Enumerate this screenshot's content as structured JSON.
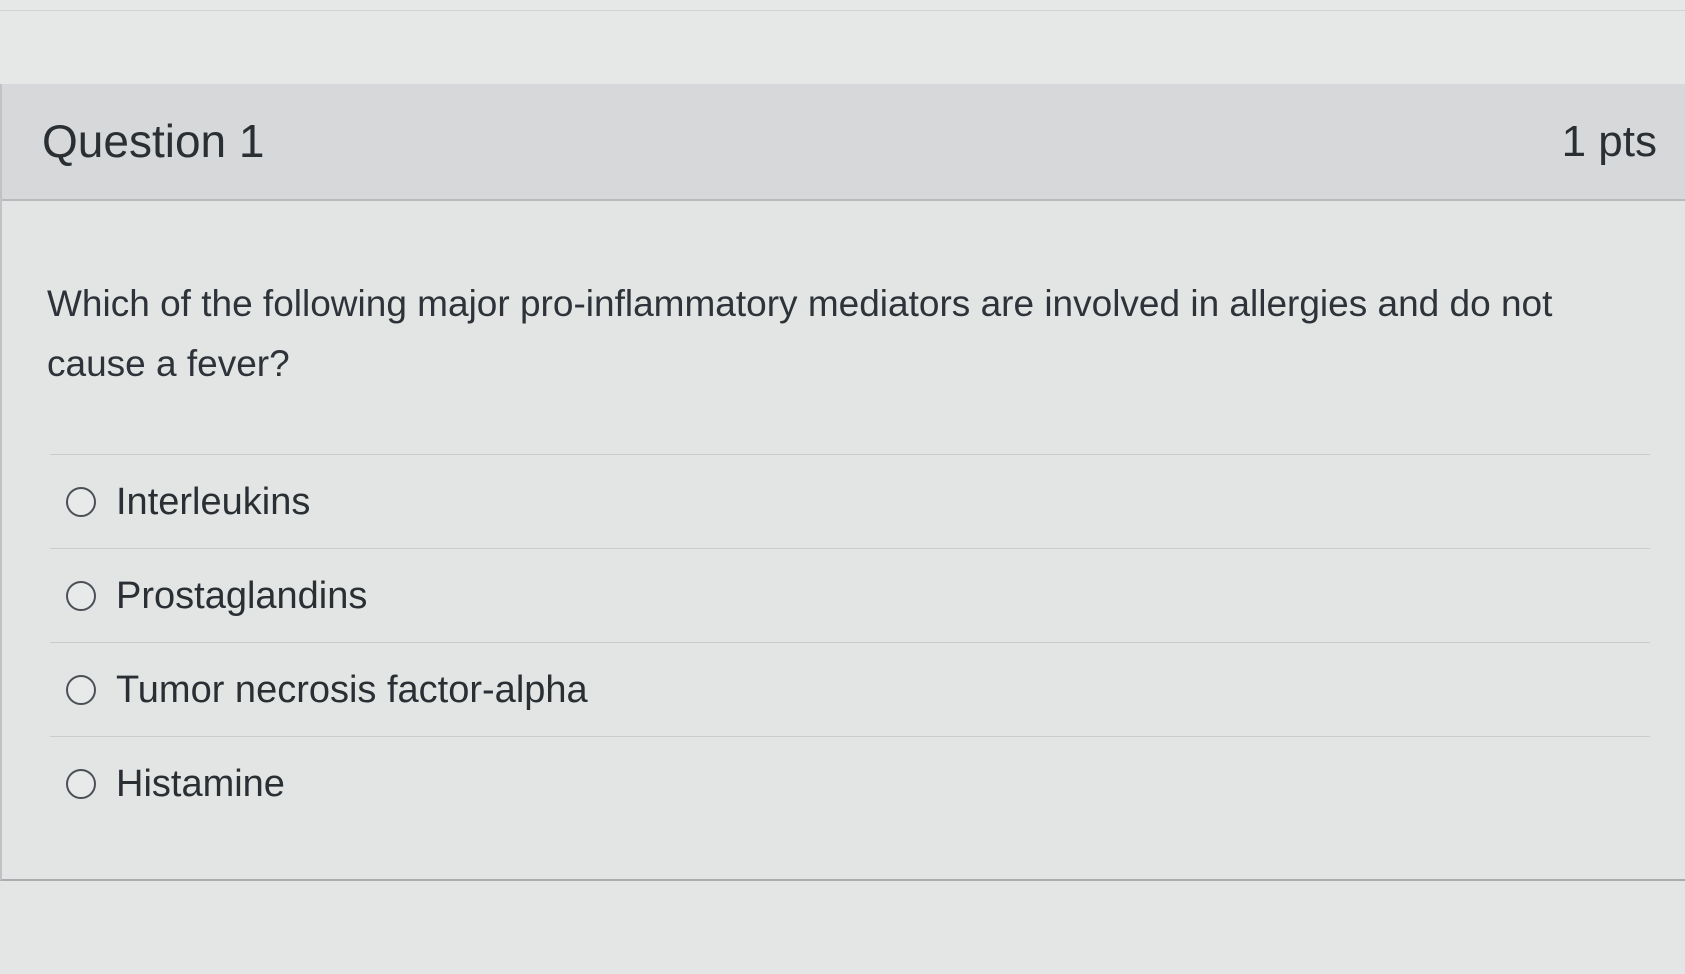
{
  "question": {
    "title": "Question 1",
    "points": "1 pts",
    "text": "Which of the following major pro-inflammatory mediators are involved in allergies and do not cause a fever?",
    "answers": [
      {
        "label": "Interleukins",
        "selected": false
      },
      {
        "label": "Prostaglandins",
        "selected": false
      },
      {
        "label": "Tumor necrosis factor-alpha",
        "selected": false
      },
      {
        "label": "Histamine",
        "selected": false
      }
    ]
  },
  "colors": {
    "header_bg": "#d6d8d9",
    "body_bg": "#e3e4e4",
    "text": "#2a2f33",
    "divider": "#c9cccd"
  }
}
